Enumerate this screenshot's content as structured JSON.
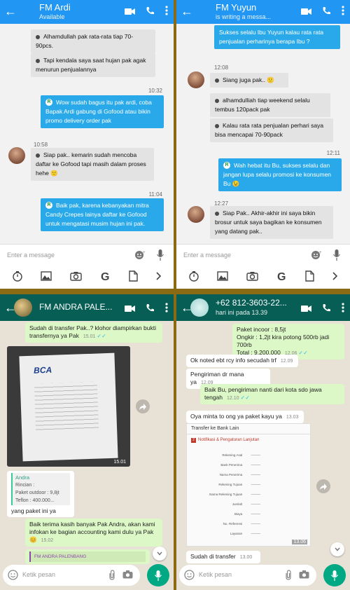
{
  "panel1": {
    "contact_name": "FM Ardi",
    "status": "Available",
    "messages": [
      {
        "text": "Alhamdullah pak rata-rata tiap 70-90pcs."
      },
      {
        "text": "Tapi kendala saya saat hujan pak agak menurun penjualannya"
      },
      {
        "time": "10:32"
      },
      {
        "badge": "R",
        "text": "Wow sudah bagus itu pak ardi, coba Bapak Ardi gabung di Gofood atau bikin promo delivery order pak"
      },
      {
        "time": "10:58"
      },
      {
        "text": "Siap pak.. kemarin sudah mencoba daftar ke Gofood tapi masih dalam proses hehe 🙂"
      },
      {
        "time": "11:04"
      },
      {
        "badge": "R",
        "text": "Baik pak, karena kebanyakan mitra Candy Crepes lainya daftar ke Gofood untuk mengatasi musim hujan ini pak."
      }
    ],
    "input_placeholder": "Enter a message"
  },
  "panel2": {
    "contact_name": "FM Yuyun",
    "status": "is writing a messa...",
    "messages": [
      {
        "text": "Sukses selalu Ibu Yuyun kalau rata rata penjualan perharinya berapa Ibu ?"
      },
      {
        "time": "12:08"
      },
      {
        "text": "Siang juga pak.. 🙂"
      },
      {
        "text": "alhamdulliah tiap weekend selalu tembus 120pack pak"
      },
      {
        "text": "Kalau rata rata penjualan perhari saya bisa mencapai 70-90pack"
      },
      {
        "time": "12:11"
      },
      {
        "badge": "R",
        "text": "Wah hebat itu Bu, sukses selalu dan jangan lupa selalu promosi ke konsumen Bu 😉"
      },
      {
        "time": "12:27"
      },
      {
        "text": "Siap Pak.. Akhir-akhir ini saya bikin brosur untuk saya bagikan ke konsumen yang datang pak.."
      }
    ],
    "input_placeholder": "Enter a message"
  },
  "panel3": {
    "contact_name": "FM ANDRA PALE...",
    "messages": [
      {
        "text": "Sudah di transfer Pak..? klohor diampirkan bukti transfernya ya Pak",
        "time": "15.01"
      },
      {
        "image": "BCA",
        "time": "15.01"
      },
      {
        "sender": "Andra",
        "lines": [
          "Rincian :",
          "Paket outdoor : 9,8jt",
          "Teflon : 400.000..."
        ],
        "text": "yang paket ini ya",
        "time": ""
      },
      {
        "text": "Baik terima kasih banyak Pak Andra, akan kami infokan ke bagian accounting kami dulu ya Pak😊",
        "time": "15.02"
      },
      {
        "text": "FM ANDRA PALENBANG"
      }
    ],
    "input_placeholder": "Ketik pesan"
  },
  "panel4": {
    "contact_name": "+62 812-3603-22...",
    "status": "hari ini pada 13.39",
    "messages": [
      {
        "lines": [
          "Paket incoor : 8,5jt",
          "Ongkir : 1,2jt kira potong 500rb jadi 700rb",
          "Total : 9.200.000"
        ],
        "time": "12.06"
      },
      {
        "text": "Ok noted ebt rcy info secudah trf",
        "time": "12.09"
      },
      {
        "text": "Pengiriman dr mana ya",
        "time": "12.09"
      },
      {
        "text": "Baik Bu, pengiriman nanti dari kota sdo jawa tengah",
        "time": "12.10"
      },
      {
        "text": "Oya minta to ong ya paket kayu ya",
        "time": "13.03"
      },
      {
        "image_title": "Transfer ke Bank Lain",
        "notice": "Notifikasi & Pengaturan Lanjutan",
        "time": "13.06"
      },
      {
        "text": "Sudah di transfer",
        "time": "13.00"
      }
    ],
    "input_placeholder": "Ketik pesan"
  },
  "colors": {
    "blue_header": "#2196f3",
    "blue_bubble": "#29a9e9",
    "green_header": "#075e54",
    "wa_out": "#dcf8c6"
  }
}
